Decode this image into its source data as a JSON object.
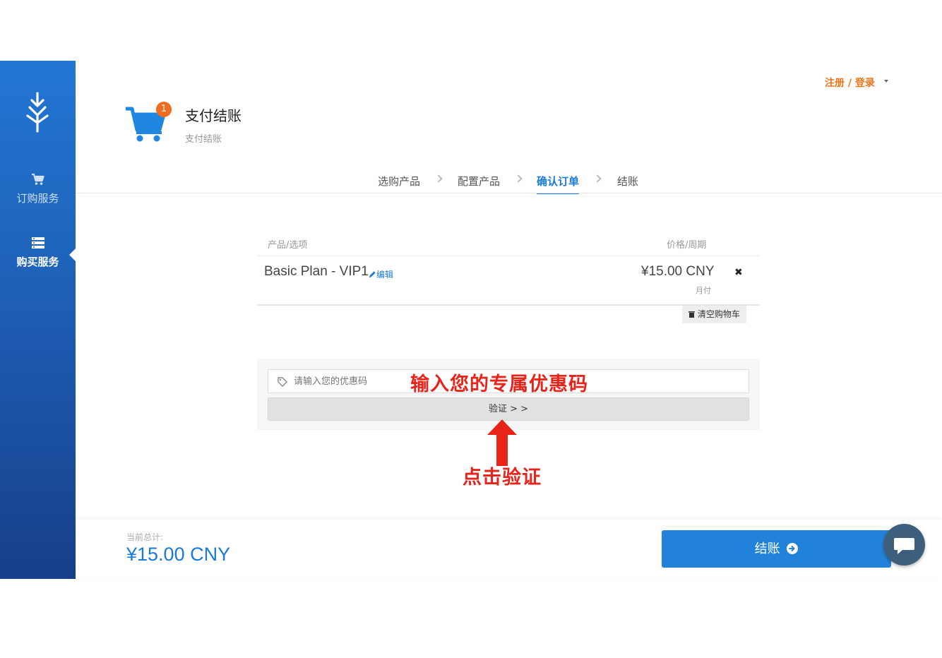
{
  "sidebar": {
    "items": [
      {
        "label": "订购服务",
        "icon": "cart-icon"
      },
      {
        "label": "购买服务",
        "icon": "server-list-icon"
      }
    ]
  },
  "header": {
    "login_label": "注册 / 登录",
    "cart_badge": "1",
    "title": "支付结账",
    "subtitle": "支付结账"
  },
  "steps": [
    {
      "label": "选购产品",
      "active": false
    },
    {
      "label": "配置产品",
      "active": false
    },
    {
      "label": "确认订单",
      "active": true
    },
    {
      "label": "结账",
      "active": false
    }
  ],
  "table": {
    "col_product": "产品/选项",
    "col_price": "价格/周期",
    "rows": [
      {
        "product": "Basic Plan - VIP1",
        "edit_label": "编辑",
        "price": "¥15.00 CNY",
        "cycle": "月付"
      }
    ],
    "empty_cart_label": "清空购物车"
  },
  "coupon": {
    "placeholder": "请输入您的优惠码",
    "verify_label": "验证 > >"
  },
  "annotations": {
    "input_hint": "输入您的专属优惠码",
    "click_hint": "点击验证"
  },
  "footer": {
    "total_label": "当前总计:",
    "total_value": "¥15.00 CNY",
    "checkout_label": "结账"
  },
  "colors": {
    "primary": "#1a7ad8",
    "accent_orange": "#f07318",
    "annotation_red": "#e8231a"
  }
}
